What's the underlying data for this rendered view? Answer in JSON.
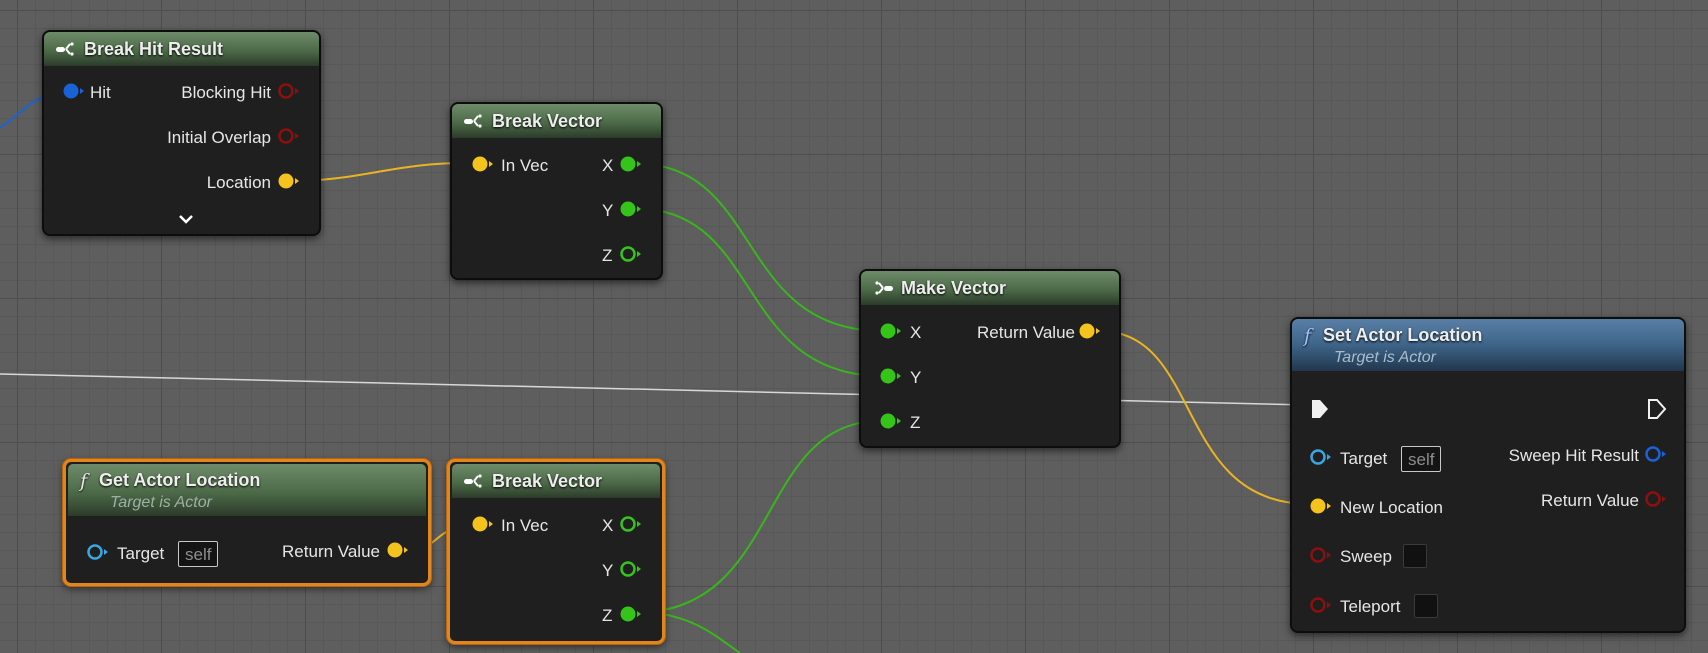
{
  "canvas": {
    "background": "#5e5e5e"
  },
  "colors": {
    "vector_pin": "#f4c31e",
    "float_pin": "#34c41a",
    "struct_pin": "#1a63d6",
    "object_pin": "#3aa6e0",
    "bool_pin": "#8c1010",
    "exec_pin": "#f0f0f0",
    "selection": "#e0861c"
  },
  "nodes": {
    "break_hit": {
      "title": "Break Hit Result",
      "icon": "break-struct-icon",
      "pin_hit": "Hit",
      "pin_blocking_hit": "Blocking Hit",
      "pin_initial_overlap": "Initial Overlap",
      "pin_location": "Location",
      "expand_icon": "chevron-down-icon"
    },
    "break_vector_1": {
      "title": "Break Vector",
      "icon": "break-struct-icon",
      "pin_in": "In Vec",
      "pin_x": "X",
      "pin_y": "Y",
      "pin_z": "Z"
    },
    "make_vector": {
      "title": "Make Vector",
      "icon": "make-struct-icon",
      "pin_x": "X",
      "pin_y": "Y",
      "pin_z": "Z",
      "pin_return": "Return Value"
    },
    "set_actor_location": {
      "title": "Set Actor Location",
      "subtitle": "Target is Actor",
      "icon": "function-icon",
      "pin_target": "Target",
      "target_value": "self",
      "pin_new_location": "New Location",
      "pin_sweep": "Sweep",
      "pin_teleport": "Teleport",
      "pin_sweep_hit": "Sweep Hit Result",
      "pin_return": "Return Value"
    },
    "get_actor_location": {
      "title": "Get Actor Location",
      "subtitle": "Target is Actor",
      "icon": "function-icon",
      "pin_target": "Target",
      "target_value": "self",
      "pin_return": "Return Value"
    },
    "break_vector_2": {
      "title": "Break Vector",
      "icon": "break-struct-icon",
      "pin_in": "In Vec",
      "pin_x": "X",
      "pin_y": "Y",
      "pin_z": "Z"
    }
  }
}
